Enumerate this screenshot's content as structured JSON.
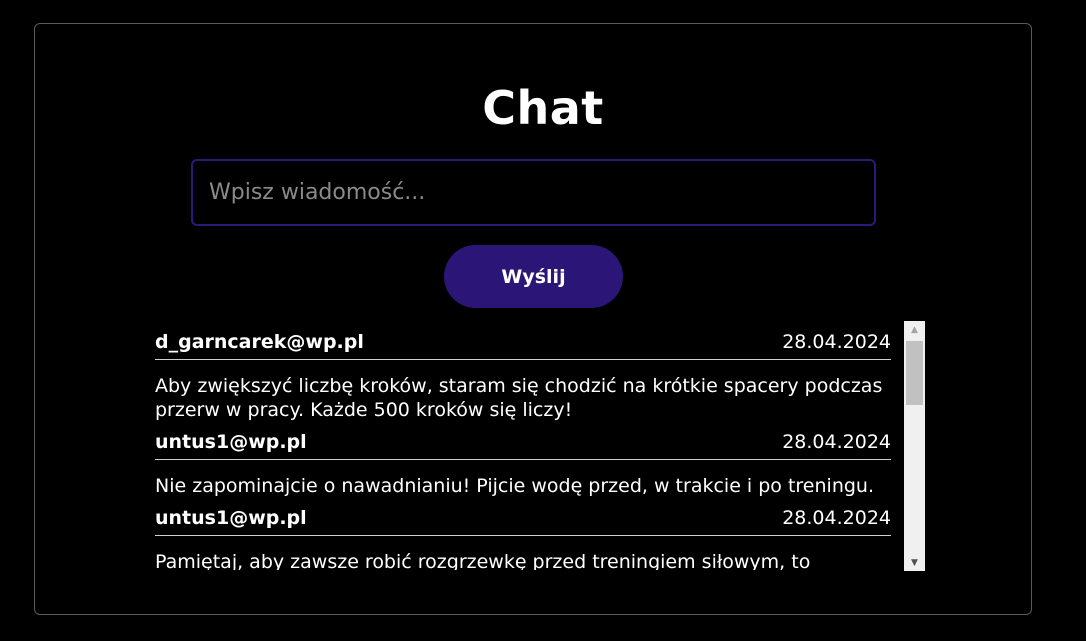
{
  "header": {
    "title": "Chat"
  },
  "composer": {
    "placeholder": "Wpisz wiadomość...",
    "value": "",
    "send_label": "Wyślij"
  },
  "messages": [
    {
      "author": "d_garncarek@wp.pl",
      "date": "28.04.2024",
      "text": "Aby zwiększyć liczbę kroków, staram się chodzić na krótkie spacery podczas przerw w pracy. Każde 500 kroków się liczy!"
    },
    {
      "author": "untus1@wp.pl",
      "date": "28.04.2024",
      "text": "Nie zapominajcie o nawadnianiu! Pijcie wodę przed, w trakcie i po treningu."
    },
    {
      "author": "untus1@wp.pl",
      "date": "28.04.2024",
      "text": "Pamiętaj, aby zawsze robić rozgrzewkę przed treningiem siłowym, to naprawdę"
    }
  ],
  "scrollbar": {
    "up_icon": "▲",
    "down_icon": "▼"
  },
  "colors": {
    "background": "#000000",
    "panel_border": "#5a5a5a",
    "accent": "#2b1678",
    "input_border": "#2a1a7a"
  }
}
